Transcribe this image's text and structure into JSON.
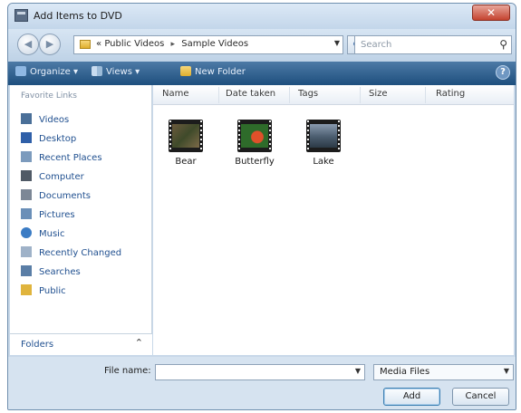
{
  "window": {
    "title": "Add Items to DVD",
    "close_glyph": "✕"
  },
  "nav": {
    "back_glyph": "◀",
    "forward_glyph": "▶",
    "breadcrumb": [
      "Public Videos",
      "Sample Videos"
    ],
    "breadcrumb_prefix": "«",
    "separator": "▸",
    "search_placeholder": "Search"
  },
  "toolbar": {
    "organize_label": "Organize ▾",
    "views_label": "Views ▾",
    "new_folder_label": "New Folder",
    "help_glyph": "?"
  },
  "sidebar": {
    "title": "Favorite Links",
    "links": [
      "Videos",
      "Desktop",
      "Recent Places",
      "Computer",
      "Documents",
      "Pictures",
      "Music",
      "Recently Changed",
      "Searches",
      "Public"
    ],
    "folders_label": "Folders",
    "folders_chevron": "⌃"
  },
  "columns": [
    "Name",
    "Date taken",
    "Tags",
    "Size",
    "Rating"
  ],
  "files": [
    {
      "name": "Bear"
    },
    {
      "name": "Butterfly"
    },
    {
      "name": "Lake"
    }
  ],
  "bottom": {
    "file_name_label": "File name:",
    "file_name_value": "",
    "file_type": "Media Files",
    "add_label": "Add",
    "cancel_label": "Cancel"
  },
  "colors": {
    "toolbar_dark": "#1e4f7e",
    "link_blue": "#1f4f8f",
    "close_red": "#c4432f"
  }
}
